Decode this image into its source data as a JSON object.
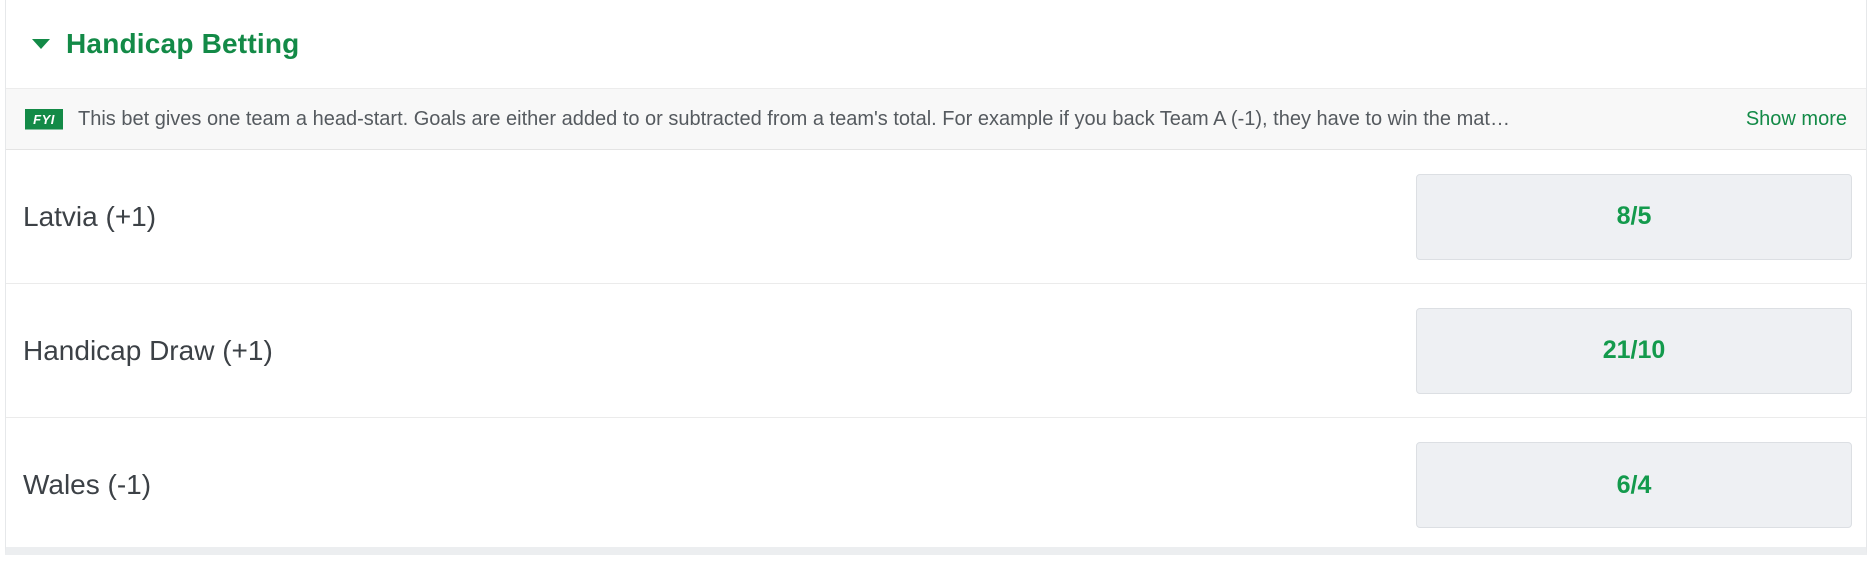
{
  "market": {
    "title": "Handicap Betting",
    "fyi": {
      "badge": "FYI",
      "text": "This bet gives one team a head-start. Goals are either added to or subtracted from a team's total. For example if you back Team A (-1), they have to win the match by 2 g...",
      "show_more_label": "Show more"
    },
    "selections": [
      {
        "name": "Latvia (+1)",
        "odds": "8/5"
      },
      {
        "name": "Handicap Draw (+1)",
        "odds": "21/10"
      },
      {
        "name": "Wales (-1)",
        "odds": "6/4"
      }
    ]
  },
  "colors": {
    "brand_green": "#138a47",
    "odds_green": "#139a4c",
    "odds_button_bg": "#eef0f3",
    "fyi_bar_bg": "#f8f8f8"
  },
  "icons": {
    "header_toggle": "caret-down-icon",
    "info_badge": "fyi-badge-icon"
  }
}
